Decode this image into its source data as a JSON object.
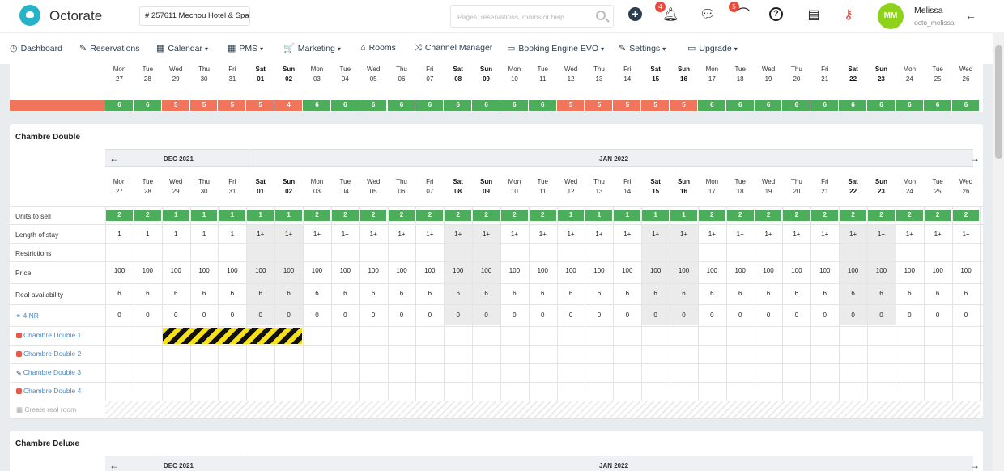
{
  "header": {
    "brand": "Octorate",
    "hotel": "# 257611  Mechou Hotel & Spa",
    "search_placeholder": "Pages, reservations, rooms or help",
    "notifications_count": "4",
    "rss_count": "5",
    "avatar_initials": "MM",
    "user_name": "Melissa",
    "user_login": "octo_melissa"
  },
  "nav": [
    {
      "label": "Dashboard",
      "icon": "dashboard-icon",
      "glyph": "◷",
      "caret": false
    },
    {
      "label": "Reservations",
      "icon": "reservations-icon",
      "glyph": "✎",
      "caret": false
    },
    {
      "label": "Calendar",
      "icon": "calendar-icon",
      "glyph": "▦",
      "caret": true
    },
    {
      "label": "PMS",
      "icon": "pms-icon",
      "glyph": "▦",
      "caret": true
    },
    {
      "label": "Marketing",
      "icon": "cart-icon",
      "glyph": "🛒",
      "caret": true
    },
    {
      "label": "Rooms",
      "icon": "home-icon",
      "glyph": "⌂",
      "caret": false
    },
    {
      "label": "Channel Manager",
      "icon": "shuffle-icon",
      "glyph": "⤨",
      "caret": false
    },
    {
      "label": "Booking Engine EVO",
      "icon": "monitor-icon",
      "glyph": "▭",
      "caret": true
    },
    {
      "label": "Settings",
      "icon": "wrench-icon",
      "glyph": "✎",
      "caret": true
    },
    {
      "label": "Upgrade",
      "icon": "card-icon",
      "glyph": "▭",
      "caret": true
    }
  ],
  "days": [
    {
      "dow": "Mon",
      "num": "27",
      "we": false
    },
    {
      "dow": "Tue",
      "num": "28",
      "we": false
    },
    {
      "dow": "Wed",
      "num": "29",
      "we": false
    },
    {
      "dow": "Thu",
      "num": "30",
      "we": false
    },
    {
      "dow": "Fri",
      "num": "31",
      "we": false
    },
    {
      "dow": "Sat",
      "num": "01",
      "we": true
    },
    {
      "dow": "Sun",
      "num": "02",
      "we": true
    },
    {
      "dow": "Mon",
      "num": "03",
      "we": false
    },
    {
      "dow": "Tue",
      "num": "04",
      "we": false
    },
    {
      "dow": "Wed",
      "num": "05",
      "we": false
    },
    {
      "dow": "Thu",
      "num": "06",
      "we": false
    },
    {
      "dow": "Fri",
      "num": "07",
      "we": false
    },
    {
      "dow": "Sat",
      "num": "08",
      "we": true
    },
    {
      "dow": "Sun",
      "num": "09",
      "we": true
    },
    {
      "dow": "Mon",
      "num": "10",
      "we": false
    },
    {
      "dow": "Tue",
      "num": "11",
      "we": false
    },
    {
      "dow": "Wed",
      "num": "12",
      "we": false
    },
    {
      "dow": "Thu",
      "num": "13",
      "we": false
    },
    {
      "dow": "Fri",
      "num": "14",
      "we": false
    },
    {
      "dow": "Sat",
      "num": "15",
      "we": true
    },
    {
      "dow": "Sun",
      "num": "16",
      "we": true
    },
    {
      "dow": "Mon",
      "num": "17",
      "we": false
    },
    {
      "dow": "Tue",
      "num": "18",
      "we": false
    },
    {
      "dow": "Wed",
      "num": "19",
      "we": false
    },
    {
      "dow": "Thu",
      "num": "20",
      "we": false
    },
    {
      "dow": "Fri",
      "num": "21",
      "we": false
    },
    {
      "dow": "Sat",
      "num": "22",
      "we": true
    },
    {
      "dow": "Sun",
      "num": "23",
      "we": true
    },
    {
      "dow": "Mon",
      "num": "24",
      "we": false
    },
    {
      "dow": "Tue",
      "num": "25",
      "we": false
    },
    {
      "dow": "Wed",
      "num": "26",
      "we": false
    }
  ],
  "overview_availability": [
    "6",
    "6",
    "5",
    "5",
    "5",
    "5",
    "4",
    "6",
    "6",
    "6",
    "6",
    "6",
    "6",
    "6",
    "6",
    "6",
    "5",
    "5",
    "5",
    "5",
    "5",
    "6",
    "6",
    "6",
    "6",
    "6",
    "6",
    "6",
    "6",
    "6",
    "6"
  ],
  "overview_low_days": [
    false,
    false,
    true,
    true,
    true,
    true,
    true,
    false,
    false,
    false,
    false,
    false,
    false,
    false,
    false,
    false,
    true,
    true,
    true,
    true,
    true,
    false,
    false,
    false,
    false,
    false,
    false,
    false,
    false,
    false,
    false
  ],
  "sections": {
    "chambre_double": {
      "title": "Chambre Double",
      "month_left": "DEC 2021",
      "month_right": "JAN 2022",
      "rows": {
        "units_label": "Units to sell",
        "units": [
          "2",
          "2",
          "1",
          "1",
          "1",
          "1",
          "1",
          "2",
          "2",
          "2",
          "2",
          "2",
          "2",
          "2",
          "2",
          "2",
          "1",
          "1",
          "1",
          "1",
          "1",
          "2",
          "2",
          "2",
          "2",
          "2",
          "2",
          "2",
          "2",
          "2",
          "2"
        ],
        "los_label": "Length of stay",
        "los": [
          "1",
          "1",
          "1",
          "1",
          "1",
          "1+",
          "1+",
          "1+",
          "1+",
          "1+",
          "1+",
          "1+",
          "1+",
          "1+",
          "1+",
          "1+",
          "1+",
          "1+",
          "1+",
          "1+",
          "1+",
          "1+",
          "1+",
          "1+",
          "1+",
          "1+",
          "1+",
          "1+",
          "1+",
          "1+",
          "1+"
        ],
        "restrictions_label": "Restrictions",
        "price_label": "Price",
        "price": "100",
        "avail_label": "Real availability",
        "avail": "6",
        "rate_label": "4 NR",
        "rate": "0"
      },
      "rooms": [
        {
          "name": "Chambre Double 1",
          "icon": "bed-icon"
        },
        {
          "name": "Chambre Double 2",
          "icon": "bed-icon"
        },
        {
          "name": "Chambre Double 3",
          "icon": "wrench-icon"
        },
        {
          "name": "Chambre Double 4",
          "icon": "bed-icon"
        }
      ],
      "create_room": "Create real room"
    },
    "chambre_deluxe": {
      "title": "Chambre Deluxe",
      "month_left": "DEC 2021",
      "month_right": "JAN 2022"
    }
  }
}
